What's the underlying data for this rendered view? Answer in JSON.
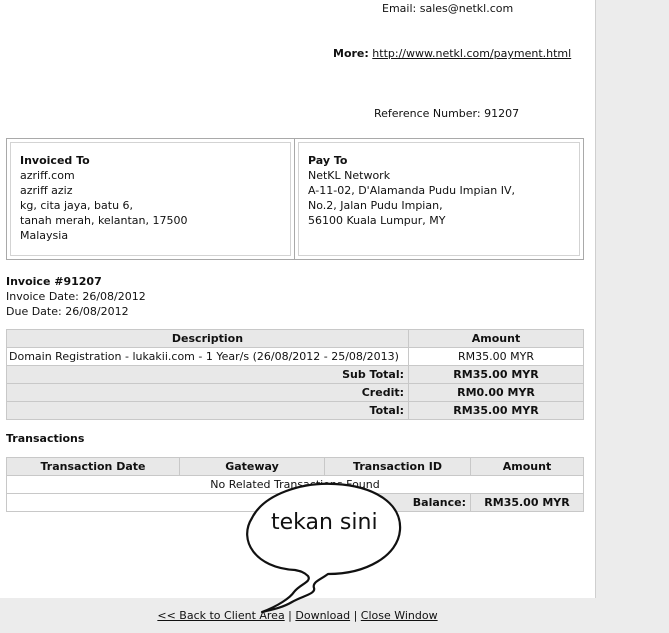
{
  "header": {
    "email": "Email: sales@netkl.com",
    "more_label": "More:",
    "more_link": "http://www.netkl.com/payment.html",
    "reference": "Reference Number: 91207"
  },
  "invoiced_to": {
    "title": "Invoiced To",
    "lines": [
      "azriff.com",
      "azriff aziz",
      "kg, cita jaya, batu 6,",
      "tanah merah, kelantan, 17500",
      "Malaysia"
    ]
  },
  "pay_to": {
    "title": "Pay To",
    "lines": [
      "NetKL Network",
      "A-11-02, D'Alamanda Pudu Impian IV,",
      "No.2, Jalan Pudu Impian,",
      "56100 Kuala Lumpur, MY"
    ]
  },
  "invoice": {
    "title": "Invoice #91207",
    "invoice_date": "Invoice Date: 26/08/2012",
    "due_date": "Due Date: 26/08/2012"
  },
  "items": {
    "headers": [
      "Description",
      "Amount"
    ],
    "rows": [
      {
        "description": "Domain Registration - lukakii.com - 1 Year/s (26/08/2012 - 25/08/2013)",
        "amount": "RM35.00 MYR"
      }
    ],
    "totals": [
      {
        "label": "Sub Total:",
        "amount": "RM35.00 MYR"
      },
      {
        "label": "Credit:",
        "amount": "RM0.00 MYR"
      },
      {
        "label": "Total:",
        "amount": "RM35.00 MYR"
      }
    ]
  },
  "transactions": {
    "title": "Transactions",
    "headers": [
      "Transaction Date",
      "Gateway",
      "Transaction ID",
      "Amount"
    ],
    "empty_text": "No Related Transactions Found",
    "balance_label": "Balance:",
    "balance_amount": "RM35.00 MYR"
  },
  "annotation": {
    "text": "tekan sini"
  },
  "footer": {
    "back_link": "<< Back to Client Area",
    "sep1": " | ",
    "download_link": "Download",
    "sep2": " | ",
    "close_link": "Close Window"
  }
}
